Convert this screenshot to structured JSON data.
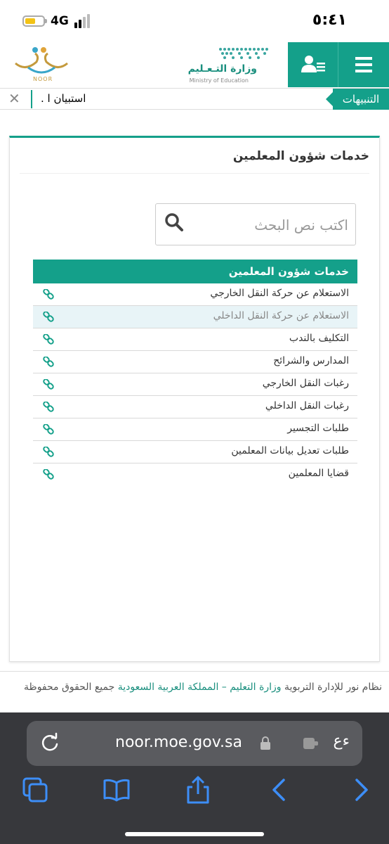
{
  "status_bar": {
    "time": "٥:٤١",
    "network": "4G"
  },
  "header": {
    "ministry_ar": "وزارة التـعـليم",
    "ministry_en": "Ministry of Education",
    "noor_label": "NOOR"
  },
  "alerts": {
    "label": "التنبيهات",
    "text": "استبيان ا .",
    "close": "✕"
  },
  "card": {
    "title": "خدمات شؤون المعلمين",
    "search_placeholder": "اكتب نص البحث"
  },
  "services": {
    "header": "خدمات شؤون المعلمين",
    "items": [
      {
        "label": "الاستعلام عن حركة النقل الخارجي"
      },
      {
        "label": "الاستعلام عن حركة النقل الداخلي"
      },
      {
        "label": "التكليف بالندب"
      },
      {
        "label": "المدارس والشرائح"
      },
      {
        "label": "رغبات النقل الخارجي"
      },
      {
        "label": "رغبات النقل الداخلي"
      },
      {
        "label": "طلبات التجسير"
      },
      {
        "label": "طلبات تعديل بيانات المعلمين"
      },
      {
        "label": "قضايا المعلمين"
      }
    ]
  },
  "footer": {
    "prefix": "نظام نور للإدارة التربوية",
    "link": "وزارة التعليم – المملكة العربية السعودية",
    "suffix": "جميع الحقوق محفوظة"
  },
  "browser": {
    "url": "noor.moe.gov.sa",
    "ext_label": "ءع"
  },
  "colors": {
    "accent": "#14a08a",
    "browser_bg": "#37383c"
  }
}
